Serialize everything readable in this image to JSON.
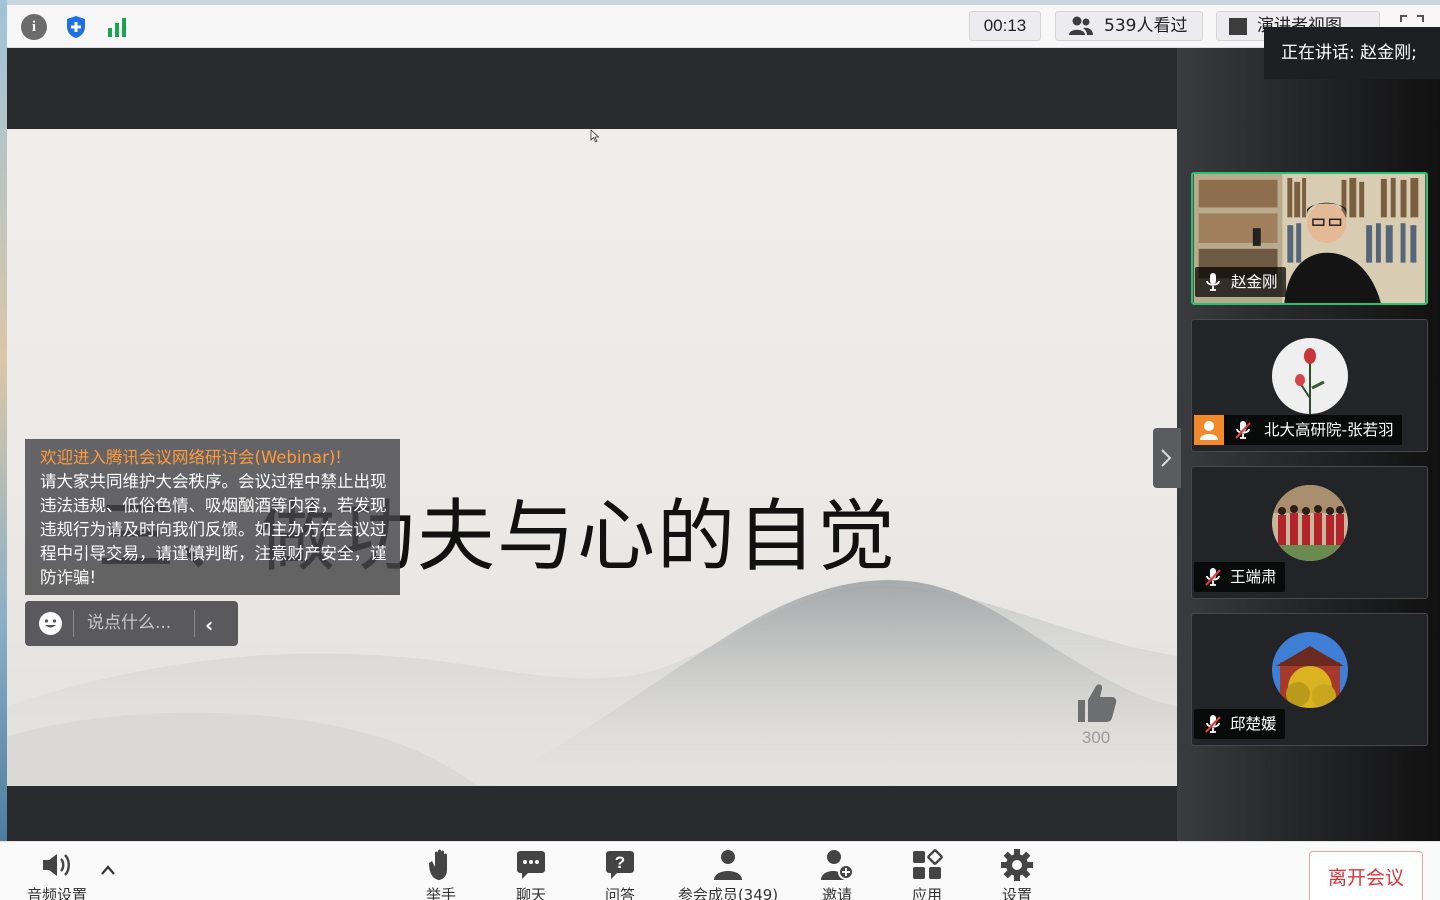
{
  "topbar": {
    "info_icon": "info-icon",
    "security_icon": "shield-icon",
    "network_icon": "signal-icon",
    "timer": "00:13",
    "viewers": "539人看过",
    "view_mode": "演讲者视图",
    "fullscreen_icon": "fullscreen-icon"
  },
  "speaking": "正在讲话: 赵金刚;",
  "slide": {
    "title": "三、做功夫与心的自觉"
  },
  "notice": {
    "title": "欢迎进入腾讯会议网络研讨会(Webinar)!",
    "body": "请大家共同维护大会秩序。会议过程中禁止出现违法违规、低俗色情、吸烟酗酒等内容，若发现违规行为请及时向我们反馈。如主办方在会议过程中引导交易，请谨慎判断，注意财产安全，谨防诈骗!"
  },
  "chat": {
    "placeholder": "说点什么..."
  },
  "like": {
    "count": "300"
  },
  "participants": [
    {
      "name": "赵金刚",
      "mic": "on"
    },
    {
      "name": "北大高研院-张若羽",
      "mic": "muted"
    },
    {
      "name": "王端肃",
      "mic": "muted"
    },
    {
      "name": "邱楚媛",
      "mic": "muted"
    }
  ],
  "toolbar": {
    "audio": "音频设置",
    "raise_hand": "举手",
    "chat": "聊天",
    "qa": "问答",
    "members": "参会成员(349)",
    "invite": "邀请",
    "apps": "应用",
    "settings": "设置",
    "leave": "离开会议"
  },
  "colors": {
    "accent_green": "#22c56e",
    "leave_red": "#d9363b",
    "notice_orange": "#ff9a3c"
  }
}
